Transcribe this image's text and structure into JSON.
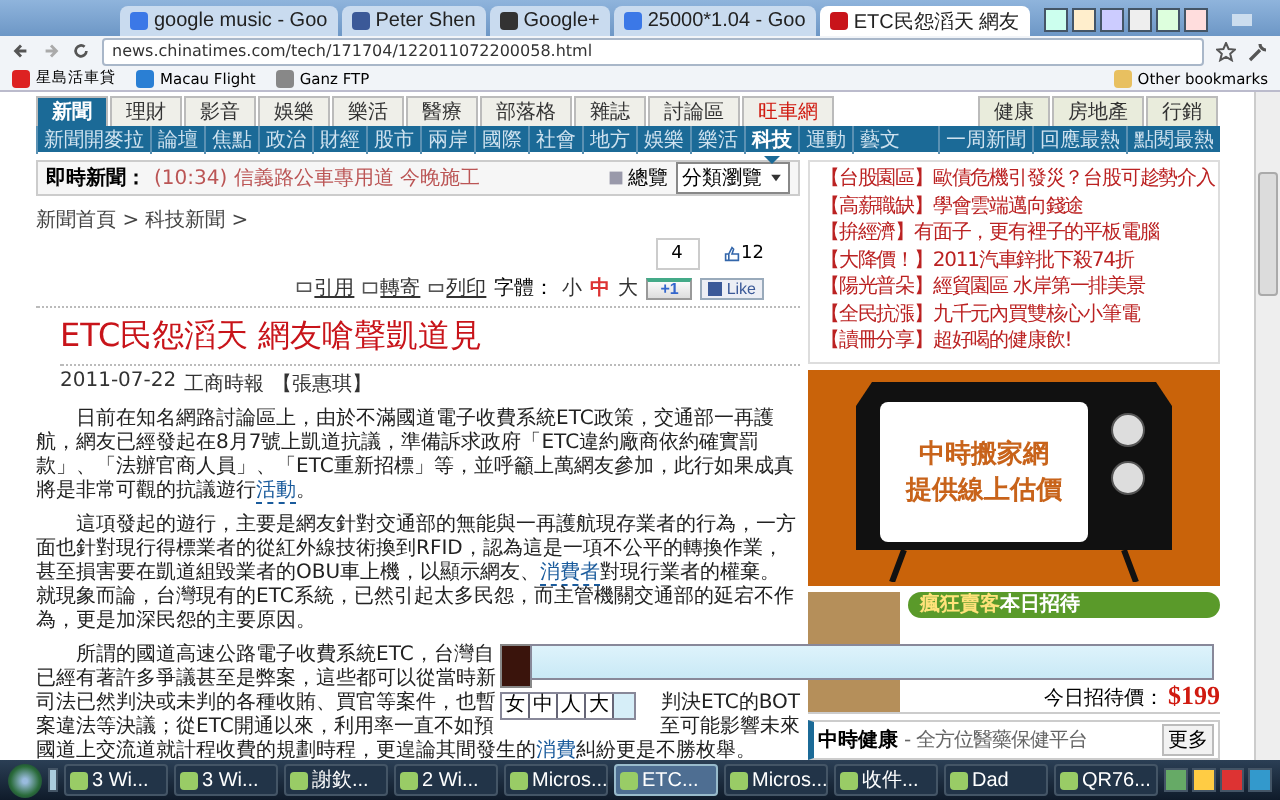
{
  "browser": {
    "tabs": [
      {
        "title": "google music - Goo",
        "kind": "google",
        "selected": false
      },
      {
        "title": "Peter Shen",
        "kind": "facebook",
        "selected": false
      },
      {
        "title": "Google+",
        "kind": "plus",
        "selected": false
      },
      {
        "title": "25000*1.04 - Goo",
        "kind": "google",
        "selected": false
      },
      {
        "title": "ETC民怨滔天 網友",
        "kind": "news",
        "selected": true
      }
    ],
    "address": "news.chinatimes.com/tech/171704/122011072200058.html",
    "bookmarks": [
      {
        "label": "星島活車貸",
        "kind": "red"
      },
      {
        "label": "Macau Flight",
        "kind": "blue"
      },
      {
        "label": "Ganz FTP",
        "kind": "globe"
      }
    ],
    "other_bookmarks": "Other bookmarks"
  },
  "site": {
    "main_nav": [
      {
        "label": "新聞",
        "selected": true,
        "highlight": false
      },
      {
        "label": "理財",
        "selected": false,
        "highlight": false
      },
      {
        "label": "影音",
        "selected": false,
        "highlight": false
      },
      {
        "label": "娛樂",
        "selected": false,
        "highlight": false
      },
      {
        "label": "樂活",
        "selected": false,
        "highlight": false
      },
      {
        "label": "醫療",
        "selected": false,
        "highlight": false
      },
      {
        "label": "部落格",
        "selected": false,
        "highlight": false
      },
      {
        "label": "雜誌",
        "selected": false,
        "highlight": false
      },
      {
        "label": "討論區",
        "selected": false,
        "highlight": false
      },
      {
        "label": "旺車網",
        "selected": false,
        "highlight": true
      }
    ],
    "main_nav_right": [
      "健康",
      "房地產",
      "行銷"
    ],
    "sub_nav": [
      {
        "label": "新聞開麥拉",
        "selected": false
      },
      {
        "label": "論壇",
        "selected": false
      },
      {
        "label": "焦點",
        "selected": false
      },
      {
        "label": "政治",
        "selected": false
      },
      {
        "label": "財經",
        "selected": false
      },
      {
        "label": "股市",
        "selected": false
      },
      {
        "label": "兩岸",
        "selected": false
      },
      {
        "label": "國際",
        "selected": false
      },
      {
        "label": "社會",
        "selected": false
      },
      {
        "label": "地方",
        "selected": false
      },
      {
        "label": "娛樂",
        "selected": false
      },
      {
        "label": "樂活",
        "selected": false
      },
      {
        "label": "科技",
        "selected": true
      },
      {
        "label": "運動",
        "selected": false
      },
      {
        "label": "藝文",
        "selected": false
      }
    ],
    "sub_nav_right": [
      "一周新聞",
      "回應最熱",
      "點閱最熱"
    ],
    "breaking": {
      "label": "即時新聞：",
      "time": "(10:34)",
      "headline": "信義路公車專用道 今晚施工",
      "overview": "總覽",
      "select": "分類瀏覽"
    },
    "breadcrumb": [
      {
        "label": "新聞首頁",
        "separator": ">"
      },
      {
        "label": "科技新聞",
        "separator": ">"
      }
    ],
    "plus_count": "4",
    "like_count": "12",
    "tools": {
      "quote": "引用",
      "forward": "轉寄",
      "print": "列印",
      "font_label": "字體：",
      "sizes": [
        {
          "label": "小",
          "selected": false
        },
        {
          "label": "中",
          "selected": true
        },
        {
          "label": "大",
          "selected": false
        }
      ],
      "plus": "+1",
      "like": "Like"
    },
    "article": {
      "title": "ETC民怨滔天 網友嗆聲凱道見",
      "date": "2011-07-22",
      "source": "工商時報",
      "author": "【張惠琪】",
      "paragraphs": [
        {
          "before": "日前在知名網路討論區上，由於不滿國道電子收費系統ETC政策，交通部一再護航，網友已經發起在8月7號上凱道抗議，準備訴求政府「ETC違約廠商依約確實罰款」、「法辦官商人員」、「ETC重新招標」等，並呼籲上萬網友參加，此行如果成真將是非常可觀的抗議遊行",
          "link": "活動",
          "after": "。"
        },
        {
          "before": "這項發起的遊行，主要是網友針對交通部的無能與一再護航現存業者的行為，一方面也針對現行得標業者的從紅外線技術換到RFID，認為這是一項不公平的轉換作業，甚至損害要在凱道組毀業者的OBU車上機，以顯示網友、",
          "link": "消費者",
          "after": "對現行業者的權棄。就現象而論，台灣現有的ETC系統，已然引起太多民怨，而主管機關交通部的延宕不作為，更是加深民怨的主要原因。"
        }
      ],
      "partial_lines": [
        {
          "segments": [
            {
              "before": "所謂的國道高速公路電子收費系統ETC，台灣自"
            }
          ]
        },
        {
          "segments": [
            {
              "before": "已經有著許多爭議甚至是弊案，這些都可以從當時新"
            }
          ]
        },
        {
          "segments": [
            {
              "before": "司法已然判決或未判的各種收賄、買官等案件，也暫"
            },
            {
              "before": "判決ETC的BOT"
            }
          ]
        },
        {
          "segments": [
            {
              "before": "案違法等決議；從ETC開通以來，利用率一直不如預"
            },
            {
              "before": "至可能影響未來"
            }
          ]
        },
        {
          "segments": [
            {
              "before": "國道上交流道就計程收費的規劃時程，更遑論其間發生的",
              "link": "消費",
              "after": "糾紛更是不勝枚舉。"
            }
          ]
        }
      ]
    },
    "promos": [
      "【台股園區】歐債危機引發災？台股可趁勢介入",
      "【高薪職缺】學會雲端邁向錢途",
      "【拚經濟】有面子，更有裡子的平板電腦",
      "【大降價！】2011汽車鋅批下殺74折",
      "【陽光普朵】經貿園區 水岸第一排美景",
      "【全民抗漲】九千元內買雙核心小筆電",
      "【讀冊分享】超好喝的健康飲!"
    ],
    "tv_ad": [
      "中時搬家網",
      "提供線上估價"
    ],
    "food_ad": {
      "banner_a": "瘋狂賣客",
      "banner_b": "本日招待",
      "price_label": "今日招待價：",
      "currency": "$",
      "price": "199"
    },
    "health": {
      "title": "中時健康",
      "subtitle": "- 全方位醫藥保健平台",
      "more": "更多"
    }
  },
  "ime_candidates": [
    "女",
    "中",
    "人",
    "大"
  ],
  "taskbar": [
    {
      "label": "3 Wi...",
      "selected": false
    },
    {
      "label": "3 Wi...",
      "selected": false
    },
    {
      "label": "謝欽...",
      "selected": false
    },
    {
      "label": "2 Wi...",
      "selected": false
    },
    {
      "label": "Micros...",
      "selected": false
    },
    {
      "label": "ETC...",
      "selected": true
    },
    {
      "label": "Micros...",
      "selected": false
    },
    {
      "label": "收件...",
      "selected": false
    },
    {
      "label": "Dad",
      "selected": false
    },
    {
      "label": "QR76...",
      "selected": false
    }
  ]
}
